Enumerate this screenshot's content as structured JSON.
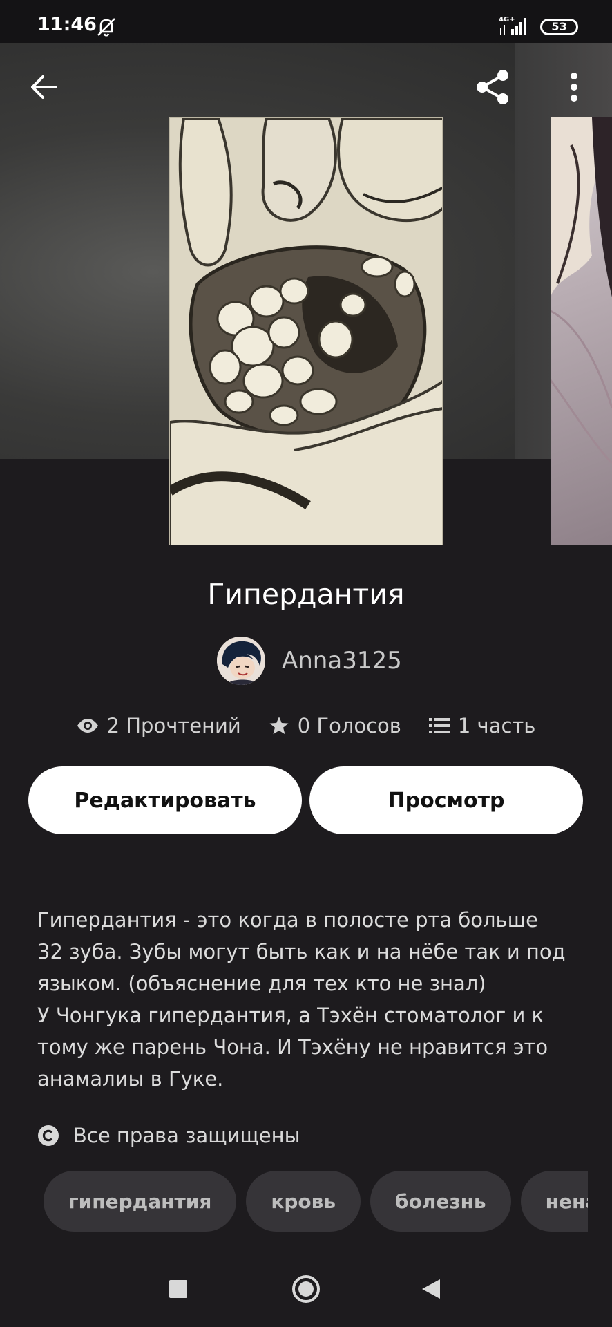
{
  "status_bar": {
    "time": "11:46",
    "network": "4G+",
    "battery": "53"
  },
  "story": {
    "title": "Гипердантия",
    "author": "Anna3125",
    "stats": {
      "reads": "2 Прочтений",
      "votes": "0 Голосов",
      "parts": "1 часть"
    },
    "description": "Гипердантия - это когда в полосте рта больше\n32 зуба. Зубы могут быть как и на нёбе так и под\nязыком. (объяснение для тех кто не знал)\nУ Чонгука гипердантия, а Тэхён стоматолог и к\nтому же парень Чона. И Тэхёну не нравится это\nанамалиы в Гуке.",
    "rights": "Все права защищены",
    "tags": [
      "гипердантия",
      "кровь",
      "болезнь",
      "ненав"
    ]
  },
  "buttons": {
    "edit": "Редактировать",
    "view": "Просмотр"
  },
  "colors": {
    "background": "#1d1b1e",
    "tag_bg": "#363438",
    "button_bg": "#ffffff"
  }
}
